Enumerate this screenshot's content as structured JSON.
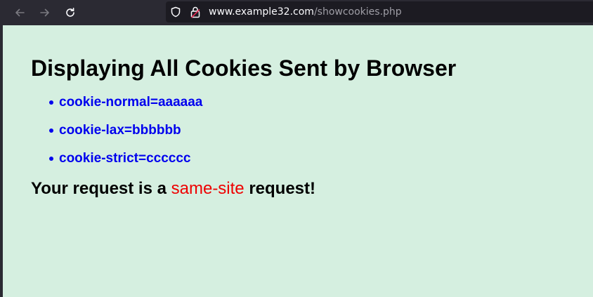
{
  "browser": {
    "url": {
      "domain": "www.example32.com",
      "path": "/showcookies.php"
    },
    "icons": {
      "back": "arrow-left-icon",
      "forward": "arrow-right-icon",
      "reload": "reload-icon",
      "tracking_protection": "shield-icon",
      "security": "lock-icon"
    }
  },
  "page": {
    "title": "Displaying All Cookies Sent by Browser",
    "cookies": [
      "cookie-normal=aaaaaa",
      "cookie-lax=bbbbbb",
      "cookie-strict=cccccc"
    ],
    "request": {
      "prefix": "Your request is a ",
      "type": "same-site",
      "suffix": " request!"
    }
  },
  "colors": {
    "page_background": "#d5efe0",
    "link_text": "#0000ee",
    "highlight_text": "#ee0000",
    "toolbar_background": "#2b2a33"
  }
}
